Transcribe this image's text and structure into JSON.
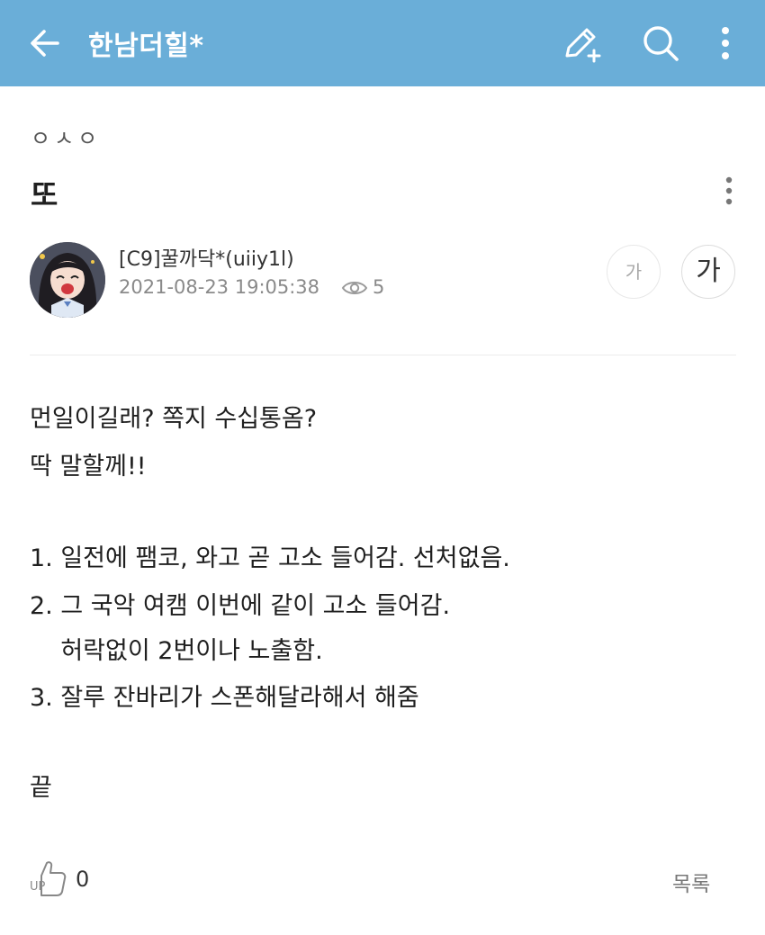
{
  "header": {
    "title": "한남더힐*",
    "back_icon": "arrow-left-icon",
    "write_icon": "pencil-plus-icon",
    "search_icon": "search-icon",
    "more_icon": "more-vertical-icon",
    "bg_color": "#6aaed8"
  },
  "post": {
    "category": "ㅇㅅㅇ",
    "title": "또",
    "author": "[C9]꿀까닥*(uiiy1l)",
    "datetime": "2021-08-23 19:05:38",
    "views": "5",
    "font_small_label": "가",
    "font_large_label": "가",
    "body_lines": [
      "먼일이길래? 쪽지 수십통옴?",
      "딱 말할께!!",
      "1. 일전에 팸코, 와고 곧 고소 들어감. 선처없음.",
      "2. 그 국악 여캠 이번에 같이 고소 들어감.",
      "    허락없이 2번이나 노출함.",
      "3. 잘루 잔바리가 스폰해달라해서 해줌",
      "끝"
    ]
  },
  "footer": {
    "like_count": "0",
    "list_label": "목록"
  }
}
